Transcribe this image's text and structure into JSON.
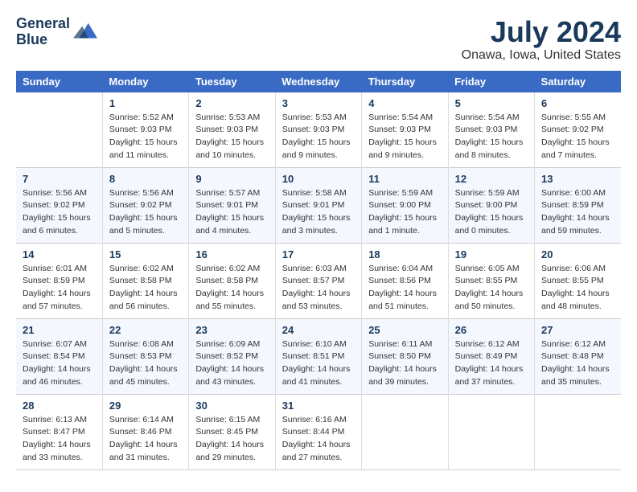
{
  "header": {
    "logo_line1": "General",
    "logo_line2": "Blue",
    "month_title": "July 2024",
    "location": "Onawa, Iowa, United States"
  },
  "days_of_week": [
    "Sunday",
    "Monday",
    "Tuesday",
    "Wednesday",
    "Thursday",
    "Friday",
    "Saturday"
  ],
  "weeks": [
    [
      {
        "day": "",
        "info": ""
      },
      {
        "day": "1",
        "info": "Sunrise: 5:52 AM\nSunset: 9:03 PM\nDaylight: 15 hours\nand 11 minutes."
      },
      {
        "day": "2",
        "info": "Sunrise: 5:53 AM\nSunset: 9:03 PM\nDaylight: 15 hours\nand 10 minutes."
      },
      {
        "day": "3",
        "info": "Sunrise: 5:53 AM\nSunset: 9:03 PM\nDaylight: 15 hours\nand 9 minutes."
      },
      {
        "day": "4",
        "info": "Sunrise: 5:54 AM\nSunset: 9:03 PM\nDaylight: 15 hours\nand 9 minutes."
      },
      {
        "day": "5",
        "info": "Sunrise: 5:54 AM\nSunset: 9:03 PM\nDaylight: 15 hours\nand 8 minutes."
      },
      {
        "day": "6",
        "info": "Sunrise: 5:55 AM\nSunset: 9:02 PM\nDaylight: 15 hours\nand 7 minutes."
      }
    ],
    [
      {
        "day": "7",
        "info": "Sunrise: 5:56 AM\nSunset: 9:02 PM\nDaylight: 15 hours\nand 6 minutes."
      },
      {
        "day": "8",
        "info": "Sunrise: 5:56 AM\nSunset: 9:02 PM\nDaylight: 15 hours\nand 5 minutes."
      },
      {
        "day": "9",
        "info": "Sunrise: 5:57 AM\nSunset: 9:01 PM\nDaylight: 15 hours\nand 4 minutes."
      },
      {
        "day": "10",
        "info": "Sunrise: 5:58 AM\nSunset: 9:01 PM\nDaylight: 15 hours\nand 3 minutes."
      },
      {
        "day": "11",
        "info": "Sunrise: 5:59 AM\nSunset: 9:00 PM\nDaylight: 15 hours\nand 1 minute."
      },
      {
        "day": "12",
        "info": "Sunrise: 5:59 AM\nSunset: 9:00 PM\nDaylight: 15 hours\nand 0 minutes."
      },
      {
        "day": "13",
        "info": "Sunrise: 6:00 AM\nSunset: 8:59 PM\nDaylight: 14 hours\nand 59 minutes."
      }
    ],
    [
      {
        "day": "14",
        "info": "Sunrise: 6:01 AM\nSunset: 8:59 PM\nDaylight: 14 hours\nand 57 minutes."
      },
      {
        "day": "15",
        "info": "Sunrise: 6:02 AM\nSunset: 8:58 PM\nDaylight: 14 hours\nand 56 minutes."
      },
      {
        "day": "16",
        "info": "Sunrise: 6:02 AM\nSunset: 8:58 PM\nDaylight: 14 hours\nand 55 minutes."
      },
      {
        "day": "17",
        "info": "Sunrise: 6:03 AM\nSunset: 8:57 PM\nDaylight: 14 hours\nand 53 minutes."
      },
      {
        "day": "18",
        "info": "Sunrise: 6:04 AM\nSunset: 8:56 PM\nDaylight: 14 hours\nand 51 minutes."
      },
      {
        "day": "19",
        "info": "Sunrise: 6:05 AM\nSunset: 8:55 PM\nDaylight: 14 hours\nand 50 minutes."
      },
      {
        "day": "20",
        "info": "Sunrise: 6:06 AM\nSunset: 8:55 PM\nDaylight: 14 hours\nand 48 minutes."
      }
    ],
    [
      {
        "day": "21",
        "info": "Sunrise: 6:07 AM\nSunset: 8:54 PM\nDaylight: 14 hours\nand 46 minutes."
      },
      {
        "day": "22",
        "info": "Sunrise: 6:08 AM\nSunset: 8:53 PM\nDaylight: 14 hours\nand 45 minutes."
      },
      {
        "day": "23",
        "info": "Sunrise: 6:09 AM\nSunset: 8:52 PM\nDaylight: 14 hours\nand 43 minutes."
      },
      {
        "day": "24",
        "info": "Sunrise: 6:10 AM\nSunset: 8:51 PM\nDaylight: 14 hours\nand 41 minutes."
      },
      {
        "day": "25",
        "info": "Sunrise: 6:11 AM\nSunset: 8:50 PM\nDaylight: 14 hours\nand 39 minutes."
      },
      {
        "day": "26",
        "info": "Sunrise: 6:12 AM\nSunset: 8:49 PM\nDaylight: 14 hours\nand 37 minutes."
      },
      {
        "day": "27",
        "info": "Sunrise: 6:12 AM\nSunset: 8:48 PM\nDaylight: 14 hours\nand 35 minutes."
      }
    ],
    [
      {
        "day": "28",
        "info": "Sunrise: 6:13 AM\nSunset: 8:47 PM\nDaylight: 14 hours\nand 33 minutes."
      },
      {
        "day": "29",
        "info": "Sunrise: 6:14 AM\nSunset: 8:46 PM\nDaylight: 14 hours\nand 31 minutes."
      },
      {
        "day": "30",
        "info": "Sunrise: 6:15 AM\nSunset: 8:45 PM\nDaylight: 14 hours\nand 29 minutes."
      },
      {
        "day": "31",
        "info": "Sunrise: 6:16 AM\nSunset: 8:44 PM\nDaylight: 14 hours\nand 27 minutes."
      },
      {
        "day": "",
        "info": ""
      },
      {
        "day": "",
        "info": ""
      },
      {
        "day": "",
        "info": ""
      }
    ]
  ]
}
